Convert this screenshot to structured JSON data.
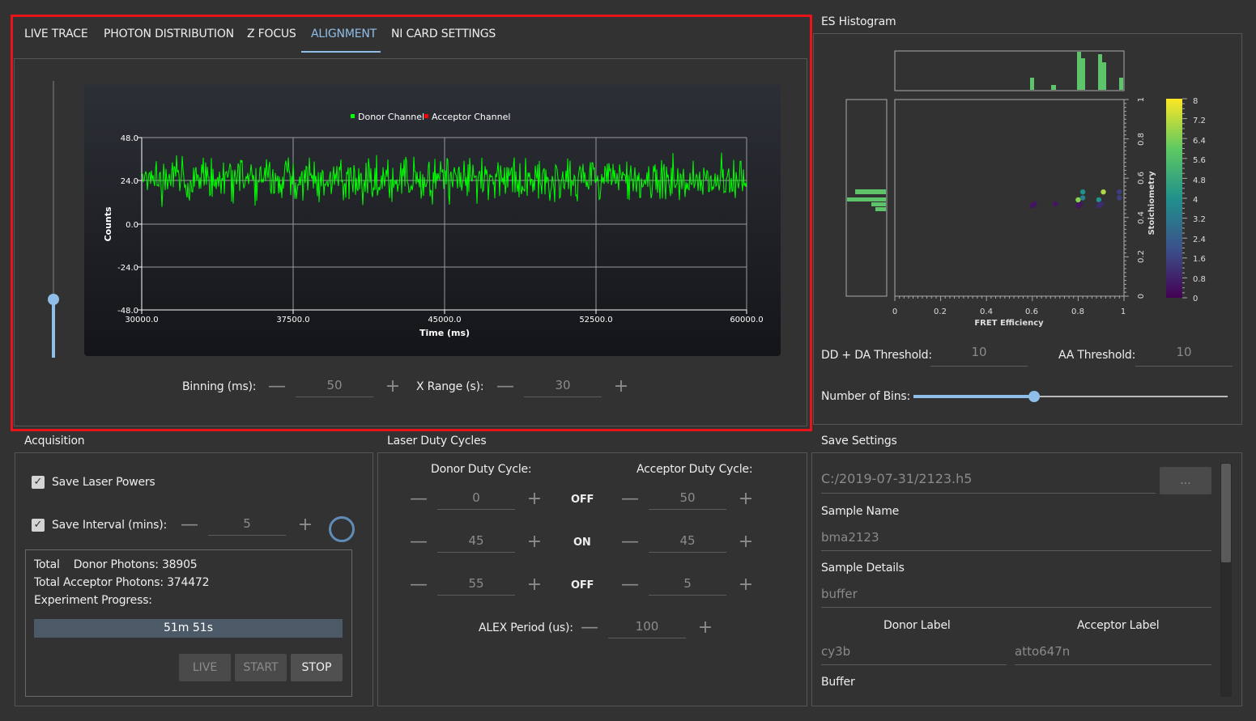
{
  "tabs": [
    {
      "label": "LIVE TRACE"
    },
    {
      "label": "PHOTON DISTRIBUTION"
    },
    {
      "label": "Z FOCUS"
    },
    {
      "label": "ALIGNMENT"
    },
    {
      "label": "NI CARD SETTINGS"
    }
  ],
  "active_tab": "ALIGNMENT",
  "trace_plot": {
    "legend": [
      "Donor Channel",
      "Acceptor Channel"
    ],
    "ylabel": "Counts",
    "xlabel": "Time (ms)",
    "yticks": [
      "48.0",
      "24.0",
      "0.0",
      "-24.0",
      "-48.0"
    ],
    "xticks": [
      "30000.0",
      "37500.0",
      "45000.0",
      "52500.0",
      "60000.0"
    ],
    "colors": {
      "donor": "#00ff00",
      "acceptor": "#ff0000"
    }
  },
  "vertical_slider": {
    "level": 0.22
  },
  "binning": {
    "label": "Binning (ms):",
    "minus": "—",
    "value": "50",
    "plus": "+"
  },
  "xrange": {
    "label": "X Range (s):",
    "minus": "—",
    "value": "30",
    "plus": "+"
  },
  "es_histogram": {
    "title": "ES Histogram",
    "xlabel": "FRET Efficiency",
    "ylabel": "Stoichiometry",
    "xticks": [
      "0",
      "0.2",
      "0.4",
      "0.6",
      "0.8",
      "1"
    ],
    "yticks": [
      "0",
      "0.2",
      "0.4",
      "0.6",
      "0.8",
      "1"
    ],
    "colorbar_ticks": [
      "8",
      "7.2",
      "6.4",
      "5.6",
      "4.8",
      "4",
      "3.2",
      "2.4",
      "1.6",
      "0.8",
      "0"
    ],
    "dd_da_threshold_label": "DD + DA Threshold:",
    "dd_da_threshold_value": "10",
    "aa_threshold_label": "AA Threshold:",
    "aa_threshold_value": "10",
    "bins_label": "Number of Bins:",
    "bins_slider_level": 0.39
  },
  "chart_data": {
    "type": "scatter",
    "xlabel": "FRET Efficiency",
    "ylabel": "Stoichiometry",
    "xlim": [
      0,
      1
    ],
    "ylim": [
      0,
      1
    ],
    "points": [
      {
        "x": 0.6,
        "y": 0.46,
        "c": 0.5
      },
      {
        "x": 0.61,
        "y": 0.47,
        "c": 0.5
      },
      {
        "x": 0.7,
        "y": 0.47,
        "c": 0.5
      },
      {
        "x": 0.8,
        "y": 0.46,
        "c": 0.5
      },
      {
        "x": 0.81,
        "y": 0.47,
        "c": 0.5
      },
      {
        "x": 0.8,
        "y": 0.49,
        "c": 6.5
      },
      {
        "x": 0.82,
        "y": 0.5,
        "c": 3.5
      },
      {
        "x": 0.82,
        "y": 0.53,
        "c": 4.0
      },
      {
        "x": 0.89,
        "y": 0.46,
        "c": 1.0
      },
      {
        "x": 0.89,
        "y": 0.49,
        "c": 4.0
      },
      {
        "x": 0.9,
        "y": 0.47,
        "c": 1.0
      },
      {
        "x": 0.91,
        "y": 0.53,
        "c": 7.0
      },
      {
        "x": 0.98,
        "y": 0.5,
        "c": 1.5
      },
      {
        "x": 0.98,
        "y": 0.53,
        "c": 1.5
      }
    ]
  },
  "acquisition": {
    "title": "Acquisition",
    "save_laser_powers": "Save Laser Powers",
    "save_interval": "Save Interval (mins):",
    "interval_minus": "—",
    "interval_value": "5",
    "interval_plus": "+",
    "total_donor": "Total    Donor Photons: 38905",
    "total_acceptor": "Total Acceptor Photons: 374472",
    "experiment_progress": "Experiment Progress:",
    "progress_text": "51m 51s",
    "btn_live": "LIVE",
    "btn_start": "START",
    "btn_stop": "STOP"
  },
  "duty": {
    "title": "Laser Duty Cycles",
    "donor_header": "Donor Duty Cycle:",
    "acceptor_header": "Acceptor Duty Cycle:",
    "rows": [
      {
        "donor": "0",
        "state": "OFF",
        "acceptor": "50"
      },
      {
        "donor": "45",
        "state": "ON",
        "acceptor": "45"
      },
      {
        "donor": "55",
        "state": "OFF",
        "acceptor": "5"
      }
    ],
    "minus": "—",
    "plus": "+",
    "alex_label": "ALEX Period (us):",
    "alex_value": "100"
  },
  "save": {
    "title": "Save Settings",
    "path": "C:/2019-07-31/2123.h5",
    "browse": "...",
    "sample_name_label": "Sample Name",
    "sample_name": "bma2123",
    "sample_details_label": "Sample Details",
    "sample_details": "buffer",
    "donor_label_header": "Donor Label",
    "acceptor_label_header": "Acceptor Label",
    "donor_label": "cy3b",
    "acceptor_label": "atto647n",
    "buffer_label": "Buffer"
  }
}
